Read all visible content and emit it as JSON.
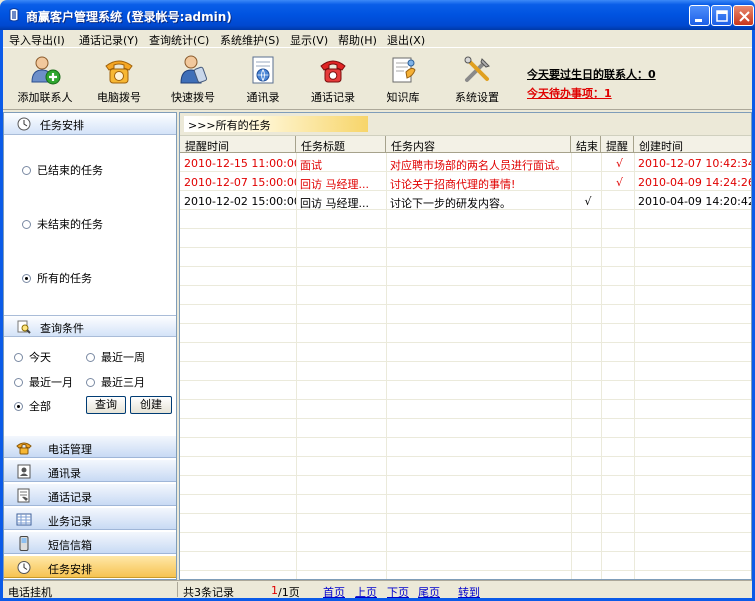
{
  "window": {
    "title": "商赢客户管理系统 (登录帐号:admin)"
  },
  "menu": [
    {
      "label": "导入导出(I)"
    },
    {
      "label": "通话记录(Y)"
    },
    {
      "label": "查询统计(C)"
    },
    {
      "label": "系统维护(S)"
    },
    {
      "label": "显示(V)"
    },
    {
      "label": "帮助(H)"
    },
    {
      "label": "退出(X)"
    }
  ],
  "toolbar": [
    {
      "label": "添加联系人",
      "icon": "add-contact-icon"
    },
    {
      "label": "电脑拨号",
      "icon": "phone-dial-icon"
    },
    {
      "label": "快速拨号",
      "icon": "quick-dial-icon"
    },
    {
      "label": "通讯录",
      "icon": "address-book-icon"
    },
    {
      "label": "通话记录",
      "icon": "call-record-icon"
    },
    {
      "label": "知识库",
      "icon": "knowledge-icon"
    },
    {
      "label": "系统设置",
      "icon": "settings-icon"
    }
  ],
  "notices": {
    "birthday": "今天要过生日的联系人：0",
    "todo": "今天待办事项：1"
  },
  "left": {
    "task_section": "任务安排",
    "task_filters": [
      {
        "label": "已结束的任务",
        "checked": false
      },
      {
        "label": "未结束的任务",
        "checked": false
      },
      {
        "label": "所有的任务",
        "checked": true
      }
    ],
    "query_section": "查询条件",
    "query_options": [
      {
        "label": "今天",
        "checked": false
      },
      {
        "label": "最近一周",
        "checked": false
      },
      {
        "label": "最近一月",
        "checked": false
      },
      {
        "label": "最近三月",
        "checked": false
      },
      {
        "label": "全部",
        "checked": true
      }
    ],
    "query_button": "查询",
    "create_button": "创建",
    "nav": [
      {
        "label": "电话管理",
        "icon": "phone-icon",
        "active": false
      },
      {
        "label": "通讯录",
        "icon": "contacts-icon",
        "active": false
      },
      {
        "label": "通话记录",
        "icon": "call-log-icon",
        "active": false
      },
      {
        "label": "业务记录",
        "icon": "business-icon",
        "active": false
      },
      {
        "label": "短信信箱",
        "icon": "sms-icon",
        "active": false
      },
      {
        "label": "任务安排",
        "icon": "task-icon",
        "active": true
      }
    ]
  },
  "main": {
    "crumb": ">>>所有的任务",
    "columns": [
      "提醒时间",
      "任务标题",
      "任务内容",
      "结束",
      "提醒",
      "创建时间"
    ],
    "rows": [
      {
        "remind": "2010-12-15 11:00:00",
        "title": "面试",
        "content": "对应聘市场部的两名人员进行面试。",
        "done": "",
        "alert": "√",
        "created": "2010-12-07 10:42:34",
        "highlight": true
      },
      {
        "remind": "2010-12-07 15:00:00",
        "title": "回访 马经理...",
        "content": "讨论关于招商代理的事情!",
        "done": "",
        "alert": "√",
        "created": "2010-04-09 14:24:26",
        "highlight": true
      },
      {
        "remind": "2010-12-02 15:00:00",
        "title": "回访 马经理...",
        "content": "讨论下一步的研发内容。",
        "done": "√",
        "alert": "",
        "created": "2010-04-09 14:20:42",
        "highlight": false
      }
    ]
  },
  "status": {
    "left": "电话挂机",
    "count": "共3条记录",
    "page": "1",
    "page_total": "/1页",
    "first": "首页",
    "prev": "上页",
    "next": "下页",
    "last": "尾页",
    "goto": "转到"
  },
  "colors": {
    "highlight_text": "#e00000",
    "link": "#0000cc"
  }
}
